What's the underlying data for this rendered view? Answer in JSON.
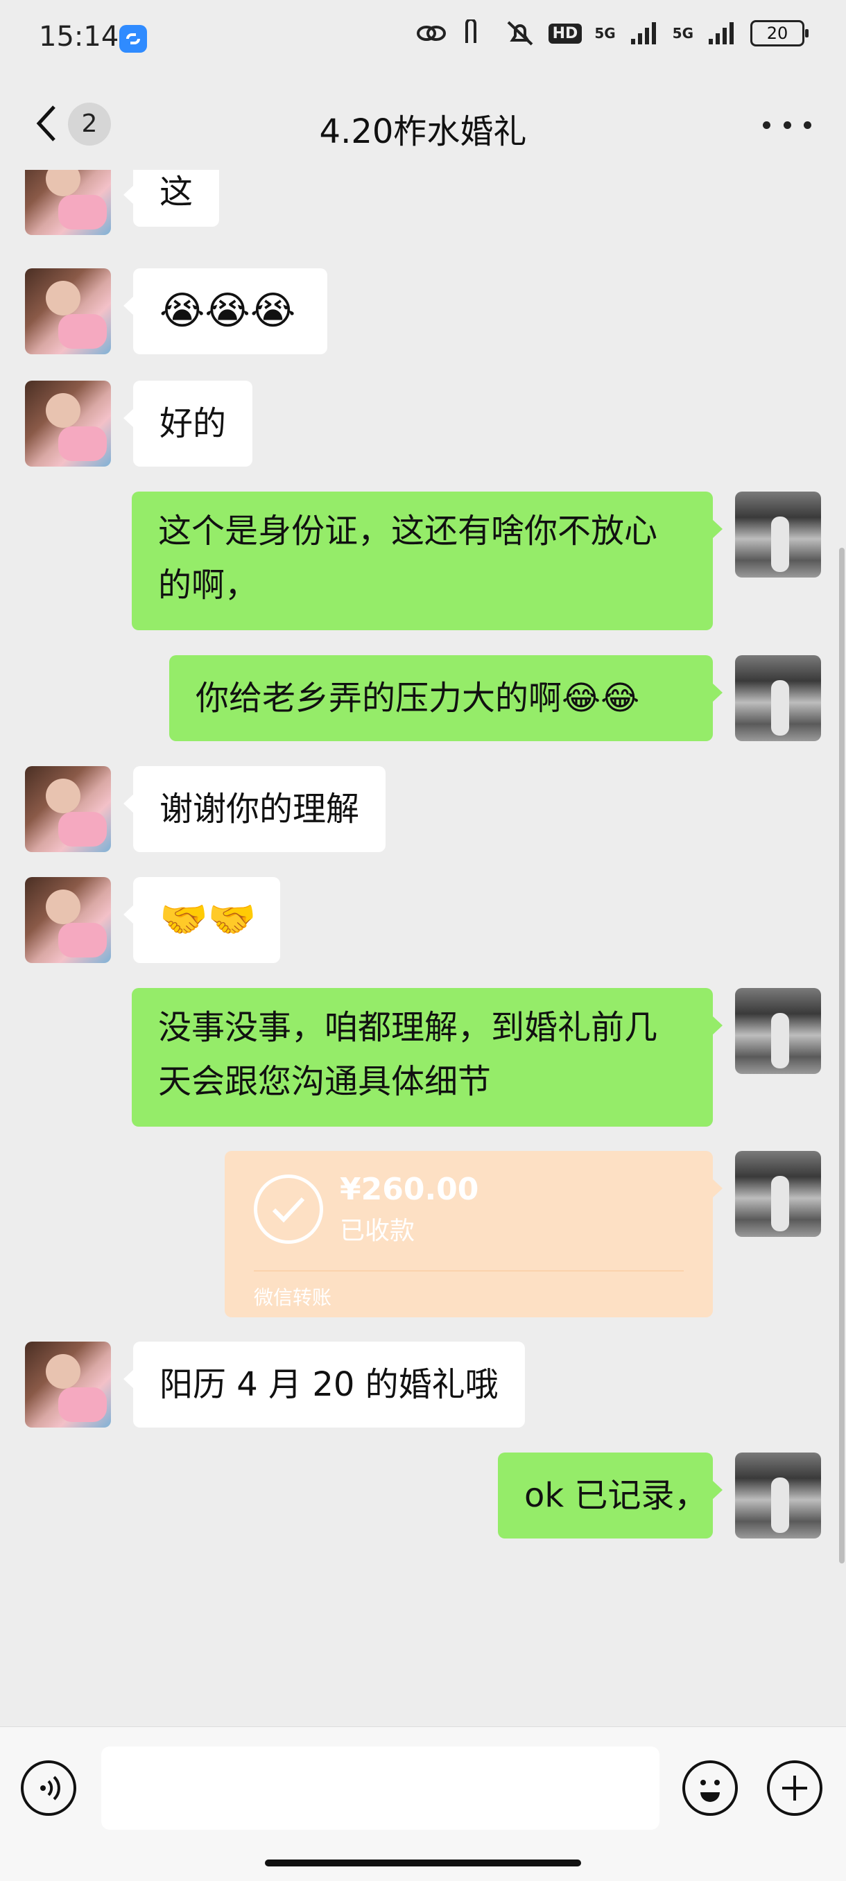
{
  "status_bar": {
    "time": "15:14",
    "app_icon": "link-app-icon",
    "network_1": "5G",
    "network_2": "5G",
    "hd_label": "HD",
    "battery": "20"
  },
  "header": {
    "title": "4.20柞水婚礼",
    "back_badge": "2"
  },
  "messages": [
    {
      "side": "left",
      "text": "这"
    },
    {
      "side": "left",
      "text": "😭😭😭"
    },
    {
      "side": "left",
      "text": "好的"
    },
    {
      "side": "right",
      "lines": [
        "这个是身份证，这还有啥你不放心",
        "的啊，"
      ]
    },
    {
      "side": "right",
      "text": "你给老乡弄的压力大的啊😂😂"
    },
    {
      "side": "left",
      "text": "谢谢你的理解"
    },
    {
      "side": "left",
      "text": "🤝🤝"
    },
    {
      "side": "right",
      "lines": [
        "没事没事，咱都理解，到婚礼前几",
        "天会跟您沟通具体细节"
      ]
    },
    {
      "side": "right",
      "type": "transfer",
      "amount": "¥260.00",
      "status": "已收款",
      "label": "微信转账"
    },
    {
      "side": "left",
      "text": "阳历 4 月 20 的婚礼哦"
    },
    {
      "side": "right",
      "text": "ok 已记录，"
    }
  ],
  "input_bar": {
    "placeholder": ""
  }
}
